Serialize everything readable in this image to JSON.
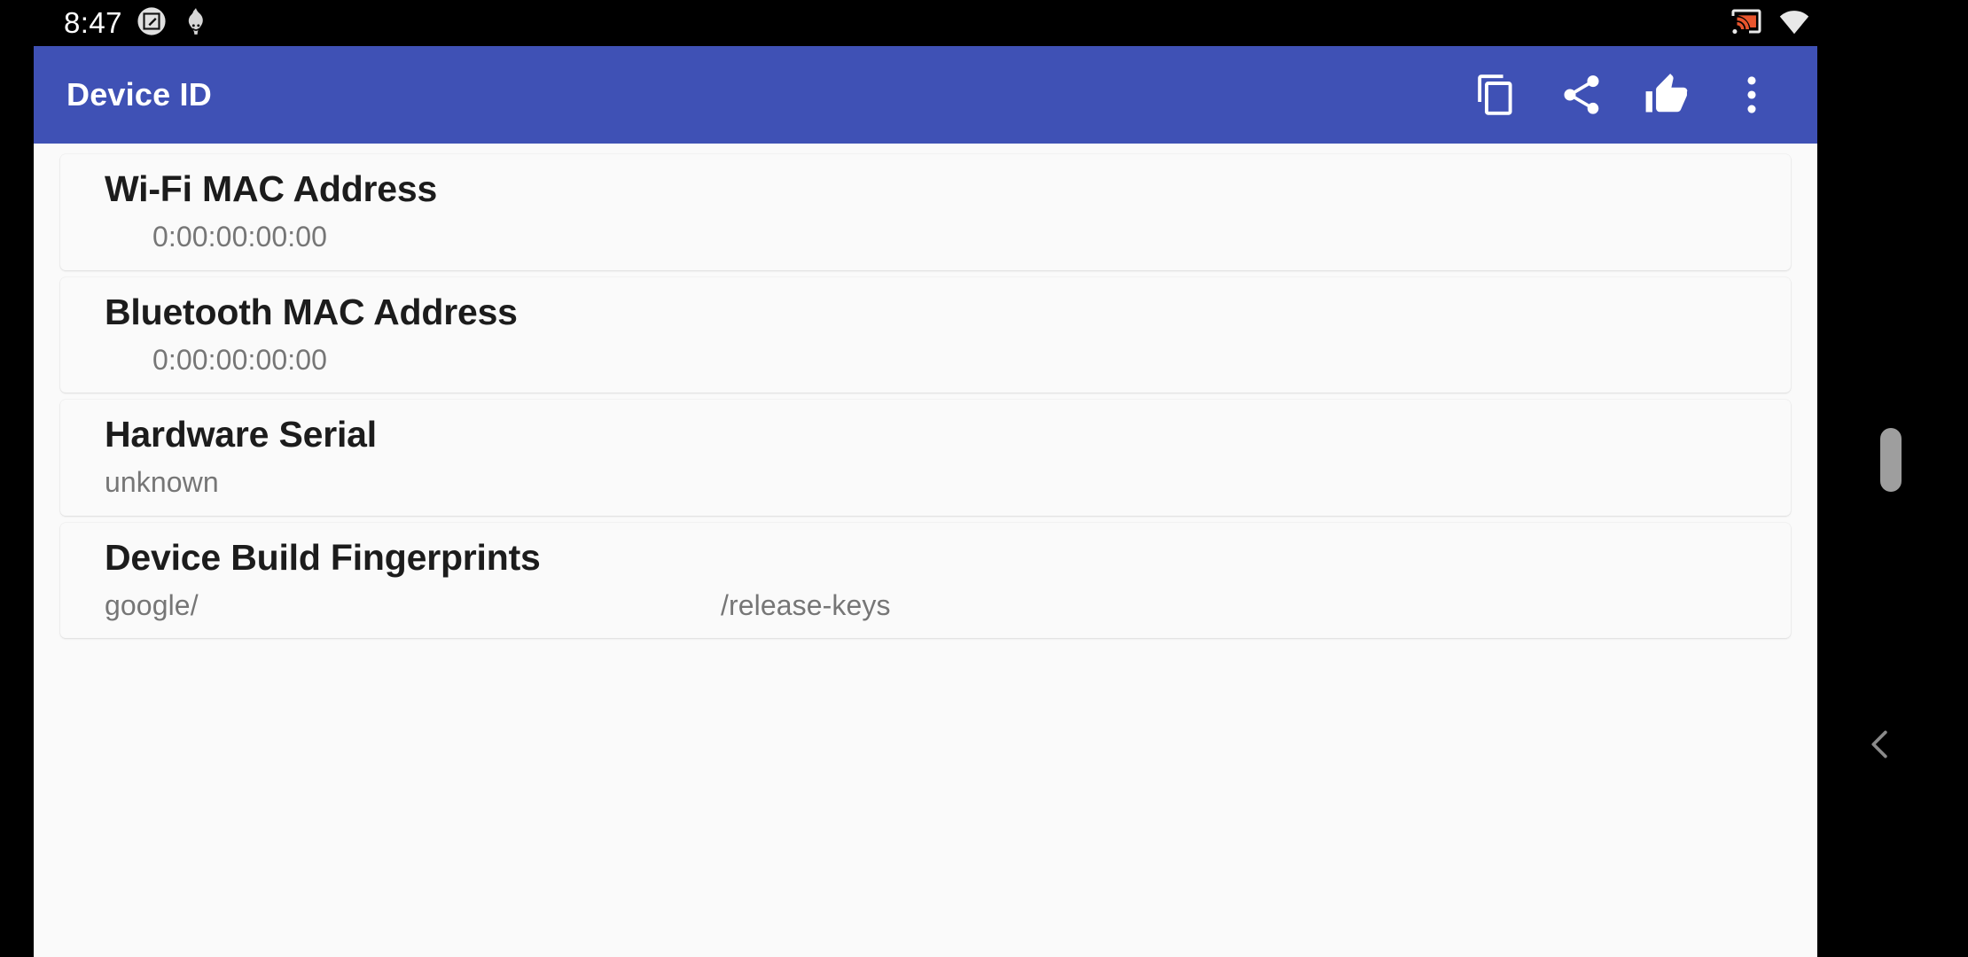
{
  "status_bar": {
    "clock": "8:47",
    "left_icons": [
      {
        "name": "screenshot-edit-icon"
      },
      {
        "name": "flame-smiley-icon"
      }
    ],
    "right_icons": [
      {
        "name": "cast-icon",
        "color": "#e8552d"
      },
      {
        "name": "wifi-icon"
      },
      {
        "name": "cellular-signal-icon"
      },
      {
        "name": "battery-charging-icon"
      }
    ],
    "background": "#000000",
    "foreground": "#ffffff"
  },
  "app_bar": {
    "title": "Device ID",
    "background": "#3f51b5",
    "foreground": "#ffffff",
    "actions": [
      {
        "name": "copy-button",
        "label": "Copy"
      },
      {
        "name": "share-button",
        "label": "Share"
      },
      {
        "name": "thumbs-up-button",
        "label": "Rate"
      },
      {
        "name": "overflow-menu-button",
        "label": "More options"
      }
    ]
  },
  "content": {
    "background": "#fafafa",
    "items": [
      {
        "title": "Wi-Fi MAC Address",
        "value": "0:00:00:00:00",
        "value_align": "indented"
      },
      {
        "title": "Bluetooth MAC Address",
        "value": "0:00:00:00:00",
        "value_align": "indented"
      },
      {
        "title": "Hardware Serial",
        "value": "unknown",
        "value_align": "flush"
      },
      {
        "title": "Device Build Fingerprints",
        "value_prefix": "google/",
        "value_suffix": "/release-keys",
        "value_align": "split"
      }
    ]
  },
  "system_nav": {
    "scroll_handle": {
      "name": "scroll-handle",
      "color": "#9e9e9e"
    },
    "back_gesture": {
      "name": "back-chevron-icon",
      "color": "#8a8a8a"
    }
  }
}
